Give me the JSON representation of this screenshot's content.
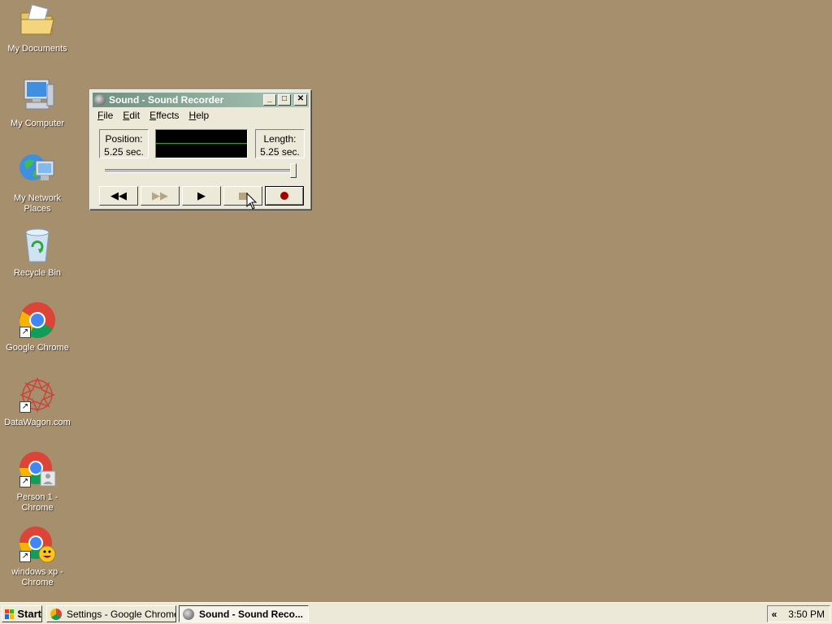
{
  "desktop": {
    "icons": [
      {
        "label": "My Documents",
        "icon": "folder-documents-icon"
      },
      {
        "label": "My Computer",
        "icon": "computer-icon"
      },
      {
        "label": "My Network Places",
        "icon": "network-places-icon"
      },
      {
        "label": "Recycle Bin",
        "icon": "recycle-bin-icon"
      },
      {
        "label": "Google Chrome",
        "icon": "chrome-icon"
      },
      {
        "label": "DataWagon.com",
        "icon": "datawagon-icon"
      },
      {
        "label": "Person 1 - Chrome",
        "icon": "chrome-person-icon"
      },
      {
        "label": "windows xp - Chrome",
        "icon": "chrome-smiley-icon"
      }
    ]
  },
  "window": {
    "title": "Sound - Sound Recorder",
    "menu": [
      "File",
      "Edit",
      "Effects",
      "Help"
    ],
    "position_label": "Position:",
    "position_value": "5.25 sec.",
    "length_label": "Length:",
    "length_value": "5.25 sec.",
    "slider_fraction": 1.0,
    "buttons": {
      "rewind": "◀◀",
      "forward": "▶▶",
      "play": "▶"
    }
  },
  "taskbar": {
    "start_label": "Start",
    "tasks": [
      {
        "label": "Settings - Google Chrome",
        "active": false
      },
      {
        "label": "Sound - Sound Reco...",
        "active": true
      }
    ],
    "tray_chevron": "«",
    "clock": "3:50 PM"
  },
  "colors": {
    "desktop": "#a68f6c",
    "titlebar_start": "#6f8f7f",
    "titlebar_end": "#a9c7b7",
    "wave_line": "#21a14a",
    "record": "#a30000"
  }
}
